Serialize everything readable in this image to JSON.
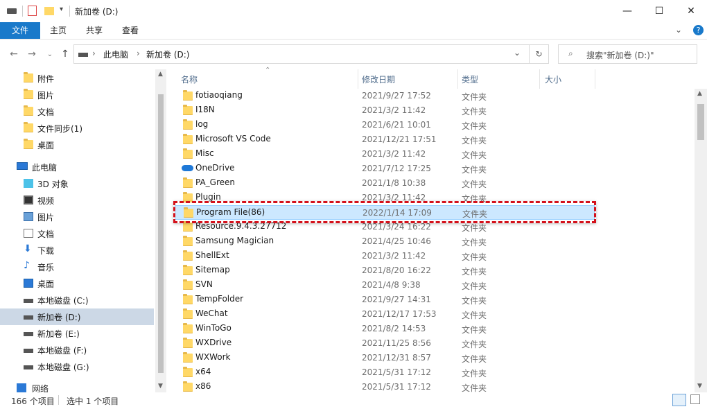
{
  "window": {
    "title": "新加卷 (D:)",
    "controls": {
      "minimize": "—",
      "maximize": "☐",
      "close": "✕"
    }
  },
  "ribbon": {
    "tabs": [
      "文件",
      "主页",
      "共享",
      "查看"
    ],
    "expand_icon": "chevron-down",
    "help_icon": "?"
  },
  "nav": {
    "breadcrumb": [
      "此电脑",
      "新加卷 (D:)"
    ],
    "search_placeholder": "搜索\"新加卷 (D:)\""
  },
  "sidebar": {
    "quick_items": [
      "附件",
      "图片",
      "文档",
      "文件同步(1)",
      "桌面"
    ],
    "this_pc": "此电脑",
    "pc_items": [
      {
        "label": "3D 对象",
        "icon": "cube-icon"
      },
      {
        "label": "视频",
        "icon": "video-icon"
      },
      {
        "label": "图片",
        "icon": "pictures-icon"
      },
      {
        "label": "文档",
        "icon": "documents-icon"
      },
      {
        "label": "下载",
        "icon": "download-icon"
      },
      {
        "label": "音乐",
        "icon": "music-icon"
      },
      {
        "label": "桌面",
        "icon": "desktop-icon"
      },
      {
        "label": "本地磁盘 (C:)",
        "icon": "drive-c-icon"
      },
      {
        "label": "新加卷 (D:)",
        "icon": "drive-icon",
        "selected": true
      },
      {
        "label": "新加卷 (E:)",
        "icon": "drive-icon"
      },
      {
        "label": "本地磁盘 (F:)",
        "icon": "drive-icon"
      },
      {
        "label": "本地磁盘 (G:)",
        "icon": "drive-icon"
      }
    ],
    "network": "网络"
  },
  "columns": {
    "name": "名称",
    "date": "修改日期",
    "type": "类型",
    "size": "大小"
  },
  "files": [
    {
      "name": "fotiaoqiang",
      "date": "2021/9/27 17:52",
      "type": "文件夹"
    },
    {
      "name": "I18N",
      "date": "2021/3/2 11:42",
      "type": "文件夹"
    },
    {
      "name": "log",
      "date": "2021/6/21 10:01",
      "type": "文件夹"
    },
    {
      "name": "Microsoft VS Code",
      "date": "2021/12/21 17:51",
      "type": "文件夹"
    },
    {
      "name": "Misc",
      "date": "2021/3/2 11:42",
      "type": "文件夹"
    },
    {
      "name": "OneDrive",
      "date": "2021/7/12 17:25",
      "type": "文件夹",
      "icon": "onedrive-icon"
    },
    {
      "name": "PA_Green",
      "date": "2021/1/8 10:38",
      "type": "文件夹"
    },
    {
      "name": "Plugin",
      "date": "2021/3/2 11:42",
      "type": "文件夹"
    },
    {
      "name": "Program File(86)",
      "date": "2022/1/14 17:09",
      "type": "文件夹",
      "selected": true
    },
    {
      "name": "Resource.9.4.3.27712",
      "date": "2021/3/24 16:22",
      "type": "文件夹"
    },
    {
      "name": "Samsung Magician",
      "date": "2021/4/25 10:46",
      "type": "文件夹"
    },
    {
      "name": "ShellExt",
      "date": "2021/3/2 11:42",
      "type": "文件夹"
    },
    {
      "name": "Sitemap",
      "date": "2021/8/20 16:22",
      "type": "文件夹"
    },
    {
      "name": "SVN",
      "date": "2021/4/8 9:38",
      "type": "文件夹"
    },
    {
      "name": "TempFolder",
      "date": "2021/9/27 14:31",
      "type": "文件夹"
    },
    {
      "name": "WeChat",
      "date": "2021/12/17 17:53",
      "type": "文件夹"
    },
    {
      "name": "WinToGo",
      "date": "2021/8/2 14:53",
      "type": "文件夹"
    },
    {
      "name": "WXDrive",
      "date": "2021/11/25 8:56",
      "type": "文件夹"
    },
    {
      "name": "WXWork",
      "date": "2021/12/31 8:57",
      "type": "文件夹"
    },
    {
      "name": "x64",
      "date": "2021/5/31 17:12",
      "type": "文件夹"
    },
    {
      "name": "x86",
      "date": "2021/5/31 17:12",
      "type": "文件夹"
    }
  ],
  "status": {
    "count": "166 个项目",
    "selection": "选中 1 个项目"
  },
  "colors": {
    "accent": "#1979ca",
    "selection": "#cce8ff",
    "highlight": "#d4111b",
    "folder": "#ffd867"
  }
}
